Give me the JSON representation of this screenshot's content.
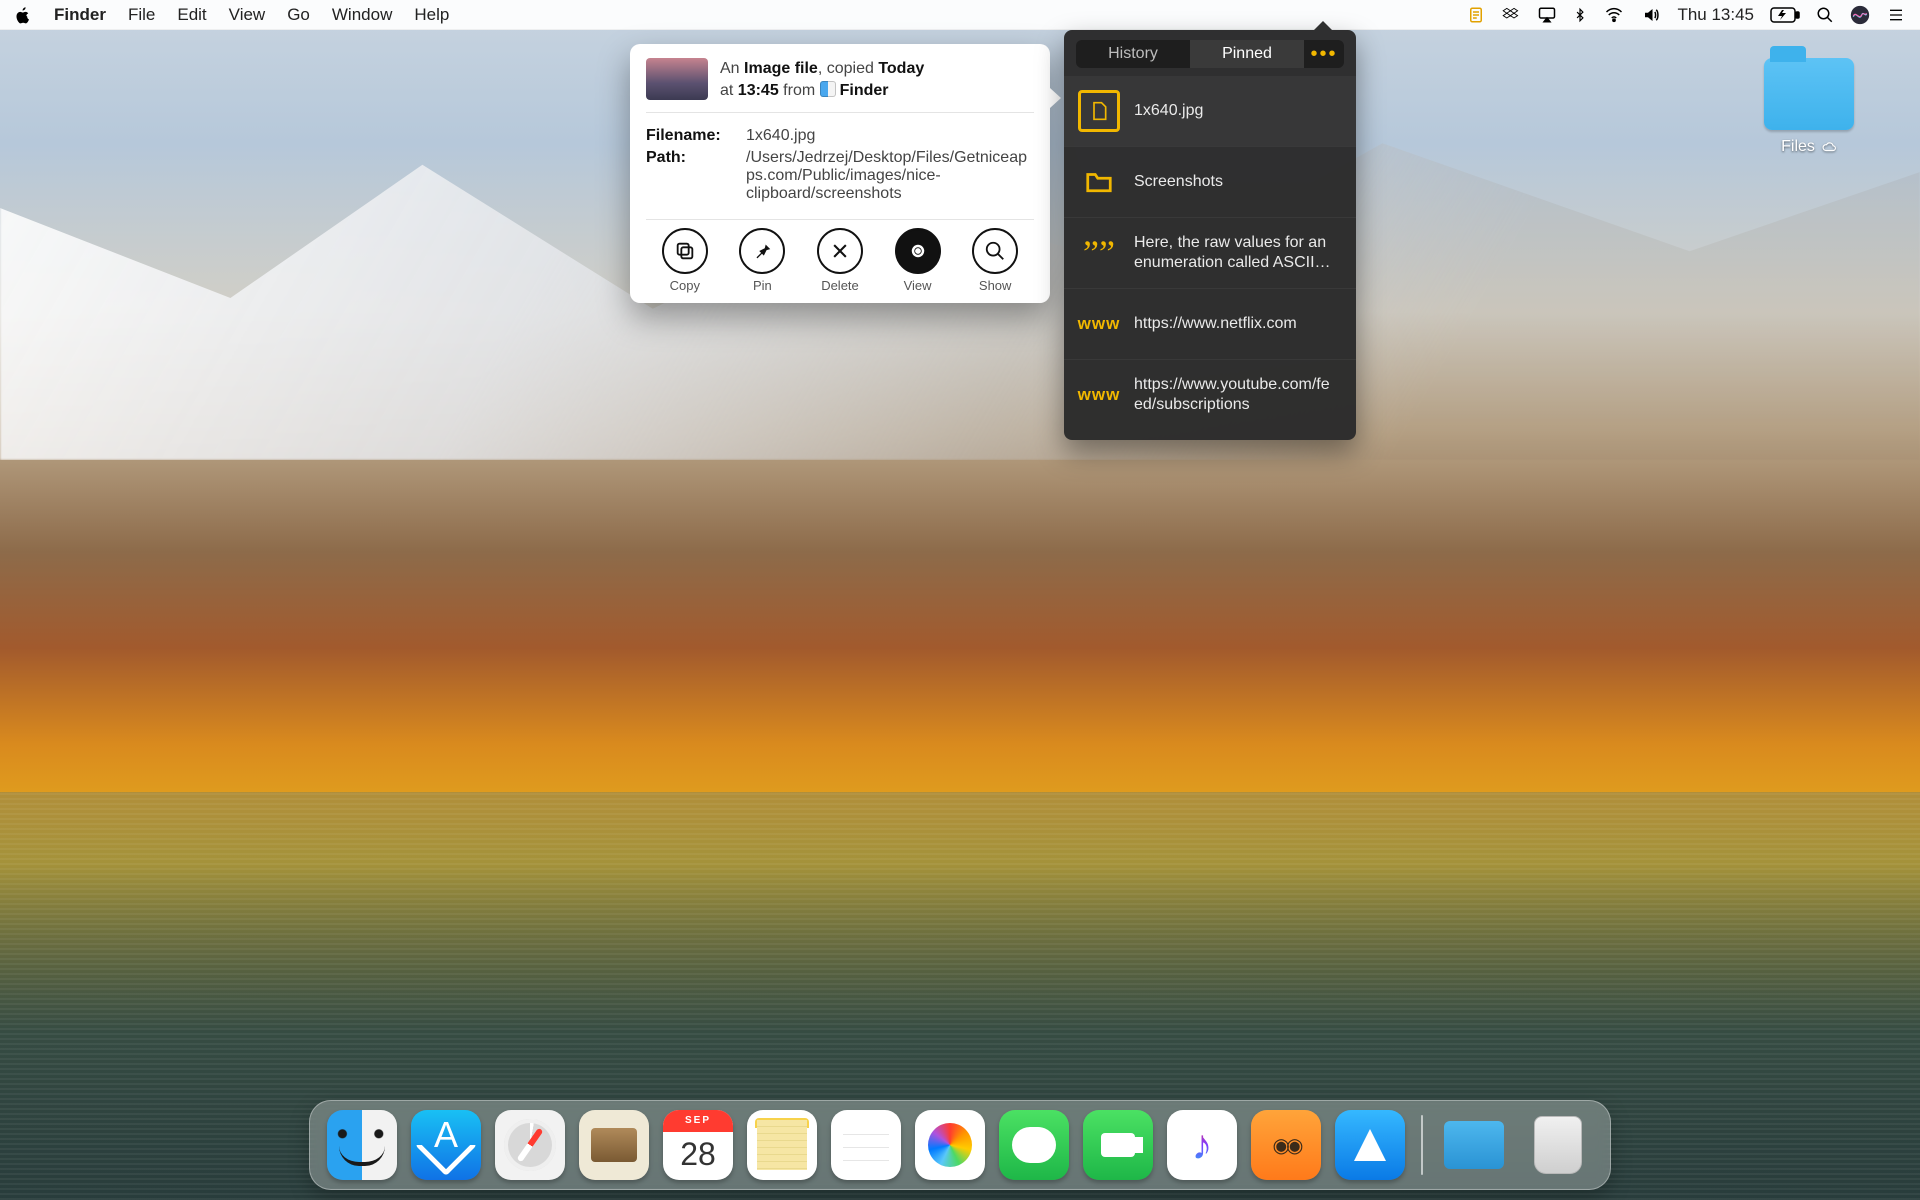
{
  "menubar": {
    "app": "Finder",
    "items": [
      "File",
      "Edit",
      "View",
      "Go",
      "Window",
      "Help"
    ],
    "status": {
      "clock": "Thu 13:45"
    }
  },
  "desktop": {
    "folder": {
      "name": "Files"
    }
  },
  "clipboard_popover": {
    "tabs": {
      "history": "History",
      "pinned": "Pinned"
    },
    "items": [
      {
        "kind": "image",
        "text": "1x640.jpg"
      },
      {
        "kind": "folder",
        "text": "Screenshots"
      },
      {
        "kind": "quote",
        "text": "Here, the raw values for an enumeration called ASCII…"
      },
      {
        "kind": "url",
        "text": "https://www.netflix.com"
      },
      {
        "kind": "url",
        "text": "https://www.youtube.com/feed/subscriptions"
      }
    ]
  },
  "detail_card": {
    "line1_pre": "An ",
    "line1_kind": "Image file",
    "line1_mid": ", copied ",
    "line1_when": "Today",
    "line2_at": "at ",
    "line2_time": "13:45",
    "line2_from": "  from ",
    "line2_app": "Finder",
    "rows": {
      "filename_label": "Filename:",
      "filename_value": "1x640.jpg",
      "path_label": "Path:",
      "path_value": "/Users/Jedrzej/Desktop/Files/Getniceapps.com/Public/images/nice-clipboard/screenshots"
    },
    "actions": {
      "copy": "Copy",
      "pin": "Pin",
      "delete": "Delete",
      "view": "View",
      "show": "Show"
    }
  },
  "dock": {
    "calendar": {
      "month": "SEP",
      "day": "28"
    }
  }
}
